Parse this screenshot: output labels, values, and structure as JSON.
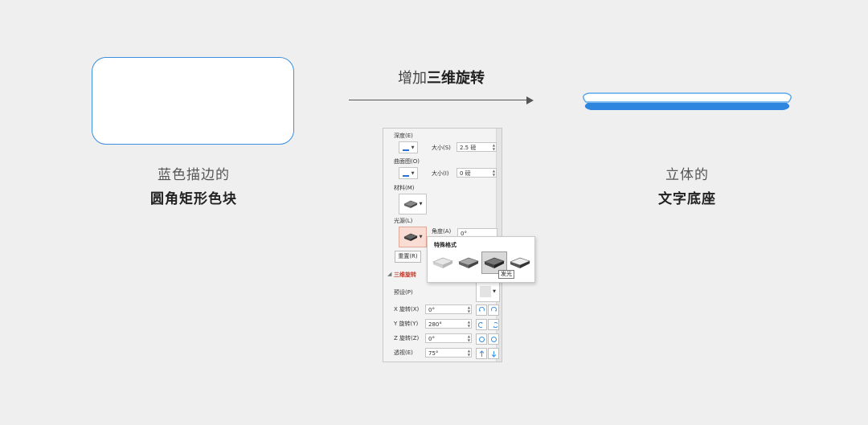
{
  "left": {
    "caption_line1": "蓝色描边的",
    "caption_line2": "圆角矩形色块",
    "outline_color": "#3a8fe0"
  },
  "middle": {
    "arrow_title_normal": "增加",
    "arrow_title_bold": "三维旋转"
  },
  "right": {
    "caption_line1": "立体的",
    "caption_line2": "文字底座",
    "base_color": "#2e86de"
  },
  "panel": {
    "depth_label": "深度(E)",
    "depth_size_label": "大小(S)",
    "depth_size_value": "2.5 磅",
    "contour_label": "曲面图(O)",
    "contour_size_label": "大小(I)",
    "contour_size_value": "0 磅",
    "material_label": "材料(M)",
    "lighting_label": "光源(L)",
    "angle_label": "角度(A)",
    "angle_value": "0°",
    "reset_label": "重置(R)",
    "section_3d_rotation": "三维旋转",
    "preset_label": "预设(P)",
    "x_rotation_label": "X 旋转(X)",
    "x_rotation_value": "0°",
    "y_rotation_label": "Y 旋转(Y)",
    "y_rotation_value": "280°",
    "z_rotation_label": "Z 旋转(Z)",
    "z_rotation_value": "0°",
    "perspective_label": "透视(E)",
    "perspective_value": "75°"
  },
  "popup": {
    "title": "特殊格式",
    "tooltip": "发光",
    "items": [
      "material-option-1",
      "material-option-2",
      "material-option-3",
      "material-option-4"
    ],
    "selected_index": 2
  }
}
